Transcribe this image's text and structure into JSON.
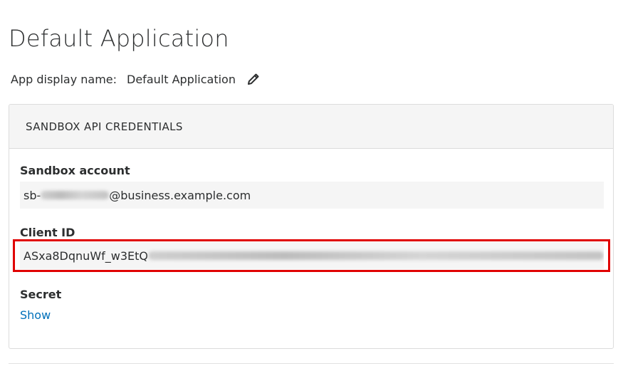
{
  "page": {
    "title": "Default Application"
  },
  "display_name": {
    "label": "App display name:",
    "value": "Default Application",
    "edit_icon": "pencil-icon"
  },
  "credentials": {
    "header": "SANDBOX API CREDENTIALS",
    "sandbox_account": {
      "label": "Sandbox account",
      "value_prefix": "sb-",
      "value_suffix": "@business.example.com"
    },
    "client_id": {
      "label": "Client ID",
      "value_visible": "ASxa8DqnuWf_w3EtQ"
    },
    "secret": {
      "label": "Secret",
      "show_label": "Show"
    }
  },
  "colors": {
    "link": "#0070ba",
    "highlight": "#e00000",
    "panel_bg": "#f5f5f5"
  }
}
